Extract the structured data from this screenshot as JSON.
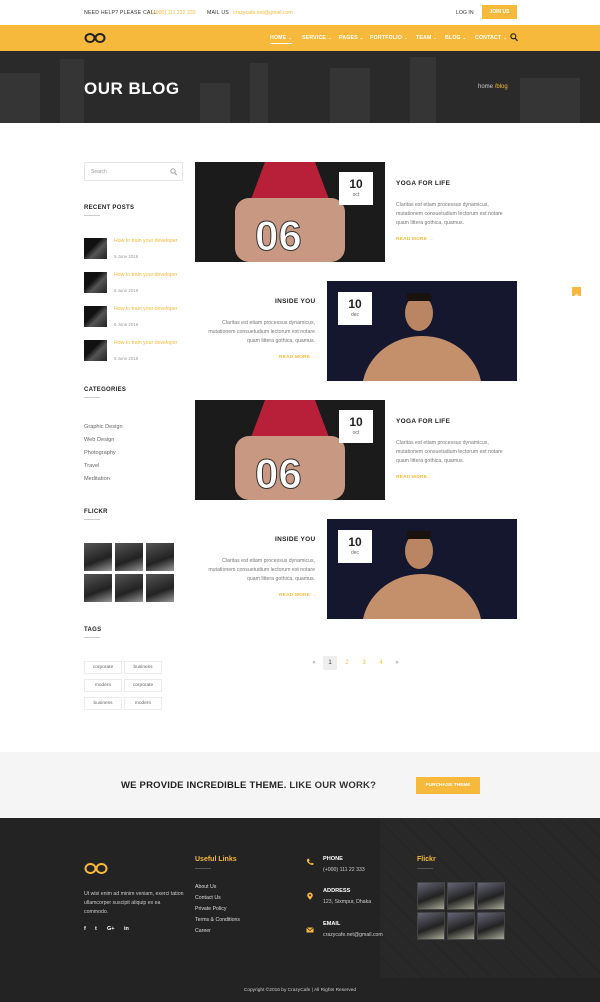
{
  "topbar": {
    "help_label": "NEED HELP? PLEASE CALL",
    "phone": "(+000) 111 222 333",
    "mail_label": "MAIL US",
    "email": "crazycafe.net@gmail.com",
    "login": "LOG IN",
    "join": "JOIN US"
  },
  "nav": {
    "items": [
      "HOME",
      "SERVICE",
      "PAGES",
      "PORTFOLIO",
      "TEAM",
      "BLOG",
      "CONTACT"
    ],
    "active": "HOME"
  },
  "banner": {
    "title": "OUR BLOG",
    "crumb_home": "home",
    "crumb_current": "/blog"
  },
  "sidebar": {
    "search_placeholder": "Search",
    "recent_heading": "RECENT POSTS",
    "recent_posts": [
      {
        "title": "How to train your developer",
        "date": "6 June 2016"
      },
      {
        "title": "How to train your developer",
        "date": "6 June 2016"
      },
      {
        "title": "How to train your developer",
        "date": "6 June 2016"
      },
      {
        "title": "How to train your developer",
        "date": "6 June 2016"
      }
    ],
    "categories_heading": "CATEGORIES",
    "categories": [
      "Graphic Design",
      "Web Design",
      "Photography",
      "Travel",
      "Meditation"
    ],
    "flickr_heading": "FLICKR",
    "tags_heading": "TAGS",
    "tags": [
      "corporate",
      "business",
      "modern",
      "corporate",
      "business",
      "modern"
    ]
  },
  "posts": [
    {
      "title": "YOGA FOR LIFE",
      "day": "10",
      "month": "oct",
      "excerpt": "Claritas est etiam processus dynamicus, mutationem consuetudium lectorum est notare quam littera gothica, quamus.",
      "read_more": "READ MORE →"
    },
    {
      "title": "INSIDE YOU",
      "day": "10",
      "month": "dec",
      "excerpt": "Claritas est etiam processus dynamicus, mutationem consuetudium lectorum est notare quam littera gothica, quamus.",
      "read_more": "READ MORE →"
    },
    {
      "title": "YOGA FOR LIFE",
      "day": "10",
      "month": "oct",
      "excerpt": "Claritas est etiam processus dynamicus, mutationem consuetudium lectorum est notare quam littera gothica, quamus.",
      "read_more": "READ MORE →"
    },
    {
      "title": "INSIDE YOU",
      "day": "10",
      "month": "dec",
      "excerpt": "Claritas est etiam processus dynamicus, mutationem consuetudium lectorum est notare quam littera gothica, quamus.",
      "read_more": "READ MORE →"
    }
  ],
  "pagination": {
    "prev": "«",
    "pages": [
      "1",
      "2",
      "3",
      "4"
    ],
    "current": "1",
    "next": "»"
  },
  "cta": {
    "text_bold": "WE PROVIDE INCREDIBLE THEME.",
    "text_light": "LIKE OUR WORK?",
    "button": "PURCHASE THEME"
  },
  "footer": {
    "about": "Ut wisi enim ad minim veniam, exerci tation ullamcorper suscipit aliquip ex ea commodo.",
    "social": [
      "f",
      "t",
      "G+",
      "in"
    ],
    "links_heading": "Useful Links",
    "links": [
      "About Us",
      "Contact Us",
      "Private Policy",
      "Terms & Conditions",
      "Career"
    ],
    "phone_label": "PHONE",
    "phone": "(+000) 111 22 333",
    "address_label": "ADDRESS",
    "address": "123, Sixmpur, Dhaka",
    "email_label": "EMAIL",
    "email": "crazycafe.net@gmail.com",
    "flickr_heading": "Flickr",
    "copyright": "Copyright ©2016 by CrazyCafe   |   All Rights Reserved"
  },
  "colors": {
    "accent": "#f6b93b",
    "dark": "#232323",
    "banner": "#2a2a2a"
  },
  "icons": {
    "search": "search-icon",
    "logo": "infinity-logo",
    "phone": "phone-icon",
    "address": "map-pin-icon",
    "email": "envelope-icon",
    "scroll": "scroll-top-icon"
  }
}
